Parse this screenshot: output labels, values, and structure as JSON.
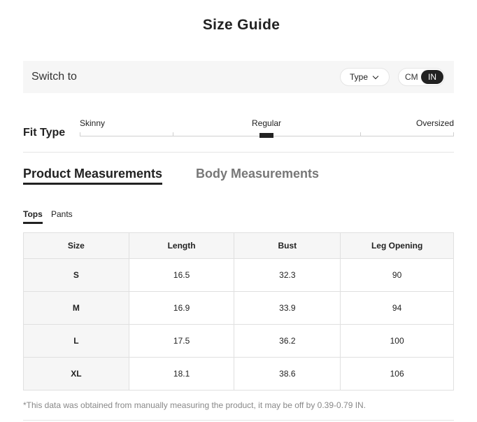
{
  "title": "Size Guide",
  "switch_bar": {
    "label": "Switch to",
    "type_button": "Type",
    "units": {
      "cm": "CM",
      "in": "IN",
      "selected": "IN"
    }
  },
  "fit_type": {
    "label": "Fit Type",
    "scale": [
      "Skinny",
      "Regular",
      "Oversized"
    ],
    "selected": "Regular"
  },
  "tabs": {
    "main": [
      "Product Measurements",
      "Body Measurements"
    ],
    "main_active": "Product Measurements",
    "sub": [
      "Tops",
      "Pants"
    ],
    "sub_active": "Tops"
  },
  "table": {
    "headers": [
      "Size",
      "Length",
      "Bust",
      "Leg Opening"
    ],
    "rows": [
      [
        "S",
        "16.5",
        "32.3",
        "90"
      ],
      [
        "M",
        "16.9",
        "33.9",
        "94"
      ],
      [
        "L",
        "17.5",
        "36.2",
        "100"
      ],
      [
        "XL",
        "18.1",
        "38.6",
        "106"
      ]
    ]
  },
  "note": "*This data was obtained from manually measuring the product, it may be off by 0.39-0.79 IN.",
  "colors": {
    "accent": "#222222",
    "panel": "#f6f6f6",
    "muted": "#888888"
  }
}
